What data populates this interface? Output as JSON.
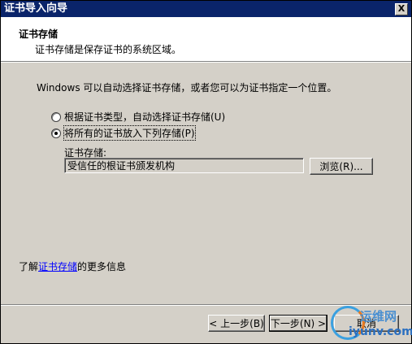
{
  "window": {
    "title": "证书导入向导",
    "close_label": "X"
  },
  "header": {
    "title": "证书存储",
    "subtitle": "证书存储是保存证书的系统区域。"
  },
  "body": {
    "instruction": "Windows 可以自动选择证书存储，或者您可以为证书指定一个位置。",
    "options": [
      {
        "label": "根据证书类型，自动选择证书存储(U)",
        "selected": false
      },
      {
        "label": "将所有的证书放入下列存储(P)",
        "selected": true
      }
    ],
    "store_label": "证书存储:",
    "store_value": "受信任的根证书颁发机构",
    "browse_label": "浏览(R)..."
  },
  "learn_more": {
    "prefix": "了解",
    "link": "证书存储",
    "suffix": "的更多信息"
  },
  "buttons": {
    "back": "< 上一步(B)",
    "next": "下一步(N) >",
    "cancel": "取消"
  },
  "watermark": {
    "cn": "运维网",
    "en": "iyunv.com"
  }
}
